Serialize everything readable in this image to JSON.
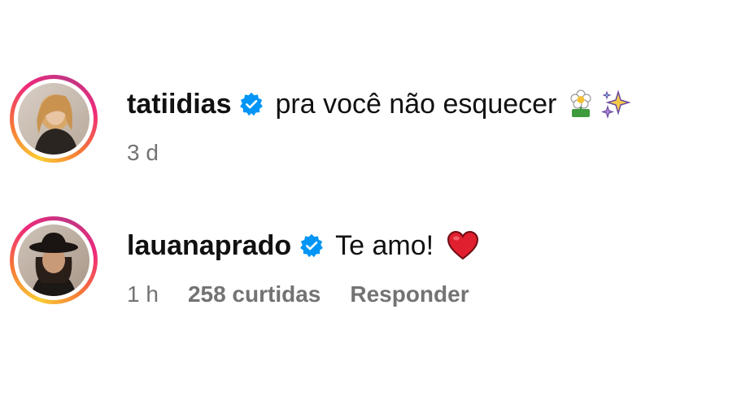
{
  "comments": [
    {
      "username": "tatiidias",
      "text": "pra você não esquecer",
      "emojis": [
        "flower-icon",
        "sparkles-icon"
      ],
      "time": "3 d",
      "verified": true
    },
    {
      "username": "lauanaprado",
      "text": "Te amo!",
      "emojis": [
        "heart-icon"
      ],
      "time": "1 h",
      "likes": "258 curtidas",
      "reply": "Responder",
      "verified": true
    }
  ],
  "colors": {
    "verified_blue": "#0095f6",
    "meta_gray": "#737373",
    "heart_red": "#e0202e"
  }
}
